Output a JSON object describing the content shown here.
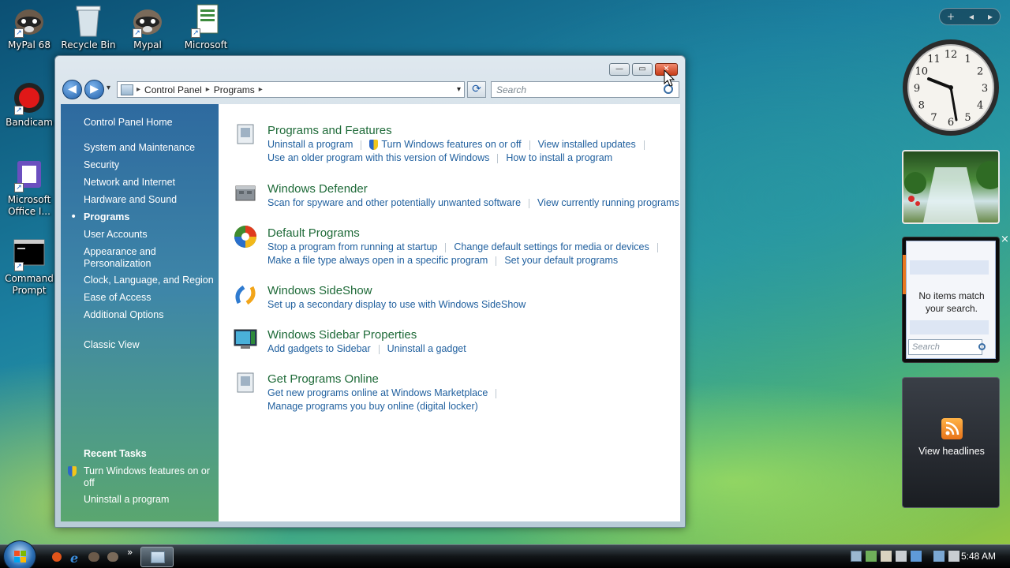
{
  "desktop": {
    "icons": [
      {
        "label": "MyPal 68"
      },
      {
        "label": "Recycle Bin"
      },
      {
        "label": "Mypal"
      },
      {
        "label": "Microsoft"
      },
      {
        "label": "Bandicam"
      },
      {
        "label_line1": "Microsoft",
        "label_line2": "Office I..."
      },
      {
        "label_line1": "Command",
        "label_line2": "Prompt"
      }
    ]
  },
  "window": {
    "buttons": {
      "minimize": "—",
      "maximize": "▭",
      "close": "✕"
    },
    "nav": {
      "back": "◀",
      "forward": "▶",
      "recent": "▾"
    },
    "address": {
      "root_marker": "▸",
      "crumbs": [
        "Control Panel",
        "Programs"
      ],
      "separator": "▸",
      "dropdown": "▾"
    },
    "refresh": "⟳",
    "search": {
      "placeholder": "Search",
      "icon": "search-icon"
    },
    "left_pane": {
      "home": "Control Panel Home",
      "items": [
        "System and Maintenance",
        "Security",
        "Network and Internet",
        "Hardware and Sound",
        "Programs",
        "User Accounts",
        "Appearance and",
        "Personalization",
        "Clock, Language, and Region",
        "Ease of Access",
        "Additional Options"
      ],
      "selected_bullet": "•",
      "classic_view": "Classic View",
      "recent_tasks_title": "Recent Tasks",
      "recent_tasks": [
        "Turn Windows features on or",
        "off",
        "Uninstall a program"
      ]
    },
    "categories": [
      {
        "title": "Programs and Features",
        "line1": [
          "Uninstall a program",
          "Turn Windows features on or off",
          "View installed updates"
        ],
        "line2": [
          "Use an older program with this version of Windows",
          "How to install a program"
        ]
      },
      {
        "title": "Windows Defender",
        "line1": [
          "Scan for spyware and other potentially unwanted software",
          "View currently running programs"
        ]
      },
      {
        "title": "Default Programs",
        "line1": [
          "Stop a program from running at startup",
          "Change default settings for media or devices"
        ],
        "line2": [
          "Make a file type always open in a specific program",
          "Set your default programs"
        ]
      },
      {
        "title": "Windows SideShow",
        "line1": [
          "Set up a secondary display to use with Windows SideShow"
        ]
      },
      {
        "title": "Windows Sidebar Properties",
        "line1": [
          "Add gadgets to Sidebar",
          "Uninstall a gadget"
        ]
      },
      {
        "title": "Get Programs Online",
        "line1": [
          "Get new programs online at Windows Marketplace"
        ],
        "line2": [
          "Manage programs you buy online (digital locker)"
        ]
      }
    ]
  },
  "sidebar": {
    "controls": {
      "add": "+",
      "prev": "◂",
      "next": "▸"
    },
    "clock_numbers": [
      "12",
      "1",
      "2",
      "3",
      "4",
      "5",
      "6",
      "7",
      "8",
      "9",
      "10",
      "11"
    ],
    "search_gadget": {
      "message_line1": "No items match",
      "message_line2": "your search.",
      "placeholder": "Search",
      "close": "×"
    },
    "feeds_gadget": {
      "label": "View headlines"
    }
  },
  "taskbar": {
    "quicklaunch_more": "»",
    "time": "5:48 AM"
  }
}
